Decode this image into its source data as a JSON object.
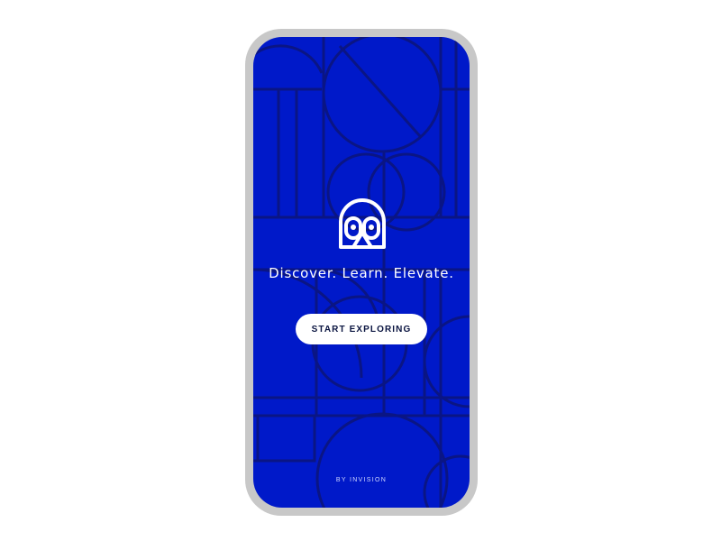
{
  "theme": {
    "screen_bg": "#0019c9",
    "pattern_stroke": "#0a1584",
    "frame": "#c8c8c8",
    "button_bg": "#ffffff",
    "button_text": "#0a1440"
  },
  "splash": {
    "logo_icon": "owl-logo-icon",
    "tagline": "Discover. Learn. Elevate.",
    "cta_label": "START EXPLORING",
    "credit": "BY INVISION"
  }
}
